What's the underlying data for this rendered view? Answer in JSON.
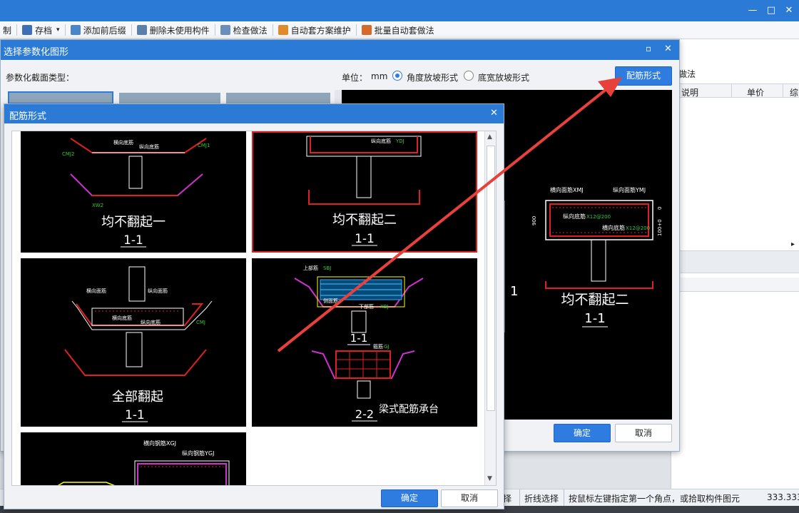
{
  "window": {
    "controls": [
      "—",
      "□",
      "✕"
    ]
  },
  "toolbar": {
    "items": [
      {
        "label": "制",
        "icon": ""
      },
      {
        "label": "存档",
        "icon": "save-icon",
        "dropdown": "▾"
      },
      {
        "label": "添加前后缀",
        "icon": "add-prefix-icon"
      },
      {
        "label": "删除未使用构件",
        "icon": "delete-unused-icon"
      },
      {
        "label": "检查做法",
        "icon": "check-method-icon"
      },
      {
        "label": "自动套方案维护",
        "icon": "auto-scheme-icon"
      },
      {
        "label": "批量自动套做法",
        "icon": "batch-auto-icon"
      }
    ]
  },
  "background_panel": {
    "method_label": "做法",
    "col_desc": "说明",
    "col_price": "单价",
    "col_total": "综"
  },
  "status": {
    "cells": [
      "择",
      "折线选择",
      "按鼠标左键指定第一个角点，或拾取构件图元",
      "333.333"
    ]
  },
  "param_dialog": {
    "title": "选择参数化图形",
    "section_type_label": "参数化截面类型：",
    "unit_label": "单位：",
    "unit_value": "mm",
    "radio_angle": "角度放坡形式",
    "radio_width": "底宽放坡形式",
    "rebar_button": "配筋形式",
    "preview": {
      "title": "均不翻起二",
      "section": "1-1",
      "labels": {
        "top_horizontal": "横向面筋XMJ",
        "top_longitudinal": "纵向面筋YMJ",
        "bottom_longitudinal": "纵向底筋",
        "bottom_horizontal": "横向底筋",
        "spec1": "X12@200",
        "spec2": "X12@200",
        "dim_900": "900",
        "dim_0": "0",
        "dim_100": "100+0"
      }
    },
    "partial_label": "1",
    "ok": "确定",
    "cancel": "取消"
  },
  "rebar_dialog": {
    "title": "配筋形式",
    "tiles": [
      {
        "title": "均不翻起一",
        "section": "1-1"
      },
      {
        "title": "均不翻起二",
        "section": "1-1"
      },
      {
        "title": "全部翻起",
        "section": "1-1"
      },
      {
        "title": "梁式配筋承台",
        "section": "2-2",
        "section_top": "1-1",
        "labels": {
          "upper": "上部筋",
          "upper_code": "SBJ",
          "lower": "下部筋",
          "lower_code": "XBJ",
          "side": "侧面筋",
          "stirrup": "箍筋",
          "stirrup_code": "GJ"
        }
      },
      {
        "title": "",
        "section": "",
        "labels": {
          "h": "横向钢筋XGJ",
          "v": "纵向钢筋YGJ"
        }
      }
    ],
    "tile_small_labels": {
      "hmj": "横向面筋",
      "hdj": "横向底筋",
      "zmj": "纵向面筋",
      "zdj": "纵向底筋",
      "xdj": "XDJ",
      "ydj": "YDJ",
      "xmj": "XMJ",
      "ymj": "YMJ",
      "cmj1": "CMJ1",
      "cmj2": "CMJ2",
      "xw2": "XW2",
      "cmj": "CMJ"
    },
    "ok": "确定",
    "cancel": "取消"
  },
  "colors": {
    "accent": "#2b7bd6",
    "selected": "#e02020",
    "arrow": "#e8403a"
  }
}
